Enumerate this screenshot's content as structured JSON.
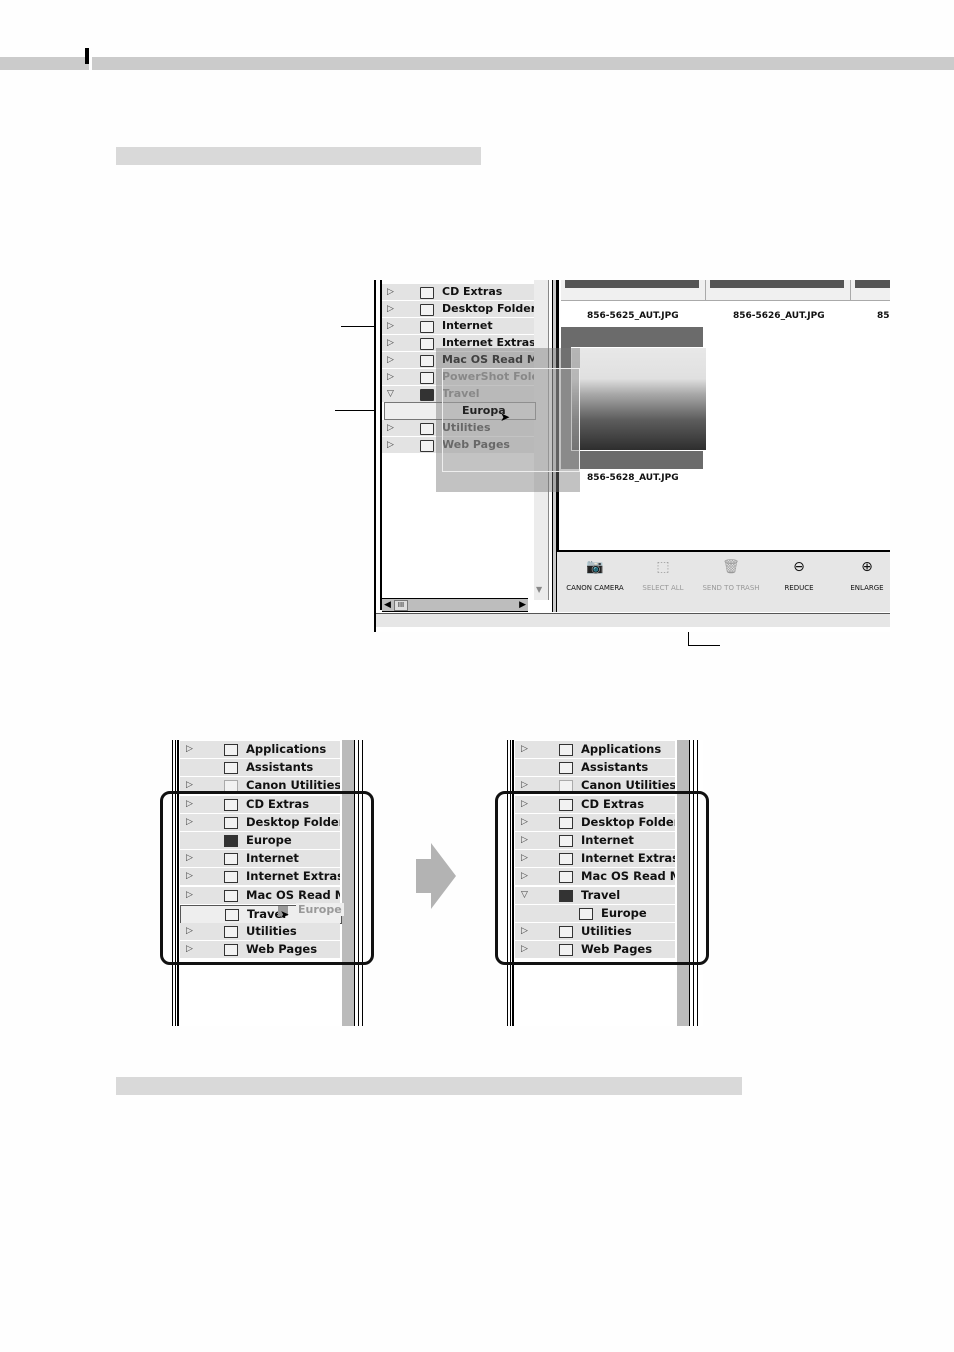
{
  "page": {
    "header_bar_color": "#cbcbcb",
    "section_bar_color": "#d9d9d9"
  },
  "main_screenshot": {
    "folder_tree": [
      {
        "label": "CD Extras",
        "expander": "collapsed",
        "icon": "folder-icon"
      },
      {
        "label": "Desktop Folder",
        "expander": "collapsed",
        "icon": "folder-icon"
      },
      {
        "label": "Internet",
        "expander": "collapsed",
        "icon": "folder-icon"
      },
      {
        "label": "Internet Extras",
        "expander": "collapsed",
        "icon": "folder-icon"
      },
      {
        "label": "Mac OS Read Me I",
        "expander": "collapsed",
        "icon": "folder-icon"
      },
      {
        "label": "PowerShot Folde",
        "expander": "collapsed",
        "icon": "folder-icon"
      },
      {
        "label": "Travel",
        "expander": "expanded",
        "icon": "folder-dark-icon"
      },
      {
        "label": "",
        "expander": "none",
        "icon": "none"
      },
      {
        "label": "Utilities",
        "expander": "collapsed",
        "icon": "folder-icon"
      },
      {
        "label": "Web Pages",
        "expander": "collapsed",
        "icon": "folder-icon"
      }
    ],
    "dragged_item_label": "Europa",
    "thumbnails": [
      {
        "filename": "856-5625_AUT.JPG"
      },
      {
        "filename": "856-5626_AUT.JPG"
      },
      {
        "filename": "85"
      }
    ],
    "selected_thumbnail": {
      "filename": "856-5628_AUT.JPG"
    },
    "toolbar": [
      {
        "label": "CANON CAMERA",
        "icon": "camera-icon",
        "enabled": true
      },
      {
        "label": "SELECT ALL",
        "icon": "select-all-icon",
        "enabled": false
      },
      {
        "label": "SEND TO TRASH",
        "icon": "trash-icon",
        "enabled": false
      },
      {
        "label": "REDUCE",
        "icon": "zoom-out-icon",
        "enabled": true
      },
      {
        "label": "ENLARGE",
        "icon": "zoom-in-icon",
        "enabled": true
      }
    ]
  },
  "before_panel": {
    "rows": [
      {
        "label": "Applications",
        "expander": "collapsed"
      },
      {
        "label": "Assistants",
        "expander": "none"
      },
      {
        "label": "Canon Utilities",
        "expander": "collapsed"
      },
      {
        "label": "CD Extras",
        "expander": "collapsed"
      },
      {
        "label": "Desktop Folder",
        "expander": "collapsed"
      },
      {
        "label": "Europe",
        "expander": "none",
        "dark": true
      },
      {
        "label": "Internet",
        "expander": "collapsed"
      },
      {
        "label": "Internet Extras",
        "expander": "collapsed"
      },
      {
        "label": "Mac OS Read Me I",
        "expander": "collapsed"
      },
      {
        "label": "Travel",
        "expander": "none",
        "drop_target": true
      },
      {
        "label": "Utilities",
        "expander": "collapsed"
      },
      {
        "label": "Web Pages",
        "expander": "collapsed"
      }
    ],
    "drag_ghost_label": "Europe"
  },
  "after_panel": {
    "rows": [
      {
        "label": "Applications",
        "expander": "collapsed"
      },
      {
        "label": "Assistants",
        "expander": "none"
      },
      {
        "label": "Canon Utilities",
        "expander": "collapsed"
      },
      {
        "label": "CD Extras",
        "expander": "collapsed"
      },
      {
        "label": "Desktop Folder",
        "expander": "collapsed"
      },
      {
        "label": "Internet",
        "expander": "collapsed"
      },
      {
        "label": "Internet Extras",
        "expander": "collapsed"
      },
      {
        "label": "Mac OS Read Me I",
        "expander": "collapsed"
      },
      {
        "label": "Travel",
        "expander": "expanded",
        "dark": true
      },
      {
        "label": "Europe",
        "expander": "none",
        "indent": true
      },
      {
        "label": "Utilities",
        "expander": "collapsed"
      },
      {
        "label": "Web Pages",
        "expander": "collapsed"
      }
    ]
  },
  "glyphs": {
    "collapsed": "▷",
    "expanded": "▽",
    "cursor": "➤",
    "left_arrow": "◀",
    "right_arrow": "▶",
    "down_arrow": "▼",
    "thumb": "III",
    "camera": "📷",
    "select": "⬚",
    "trash": "🗑",
    "zoom_out": "⊖",
    "zoom_in": "⊕"
  }
}
